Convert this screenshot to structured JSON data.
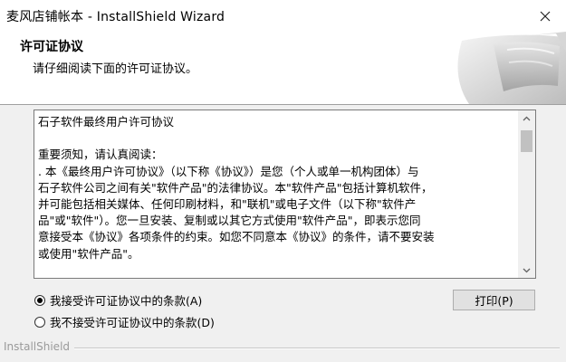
{
  "window": {
    "title": "麦风店铺帐本 - InstallShield Wizard",
    "close_icon": "close-icon"
  },
  "header": {
    "title": "许可证协议",
    "subtitle": "请仔细阅读下面的许可证协议。",
    "art_icon": "installshield-graphic"
  },
  "license": {
    "lines": [
      "石子软件最终用户许可协议",
      "",
      "重要须知，请认真阅读：",
      ". 本《最终用户许可协议》（以下称《协议》）是您（个人或单一机构团体）与",
      "石子软件公司之间有关\"软件产品\"的法律协议。本\"软件产品\"包括计算机软件，",
      "并可能包括相关媒体、任何印刷材料，和\"联机\"或电子文件（以下称\"软件产",
      "品\"或\"软件\"）。您一旦安装、复制或以其它方式使用\"软件产品\"，即表示您同",
      "意接受本《协议》各项条件的约束。如您不同意本《协议》的条件，请不要安装",
      "或使用\"软件产品\"。"
    ],
    "scroll_up_icon": "chevron-up-icon",
    "scroll_down_icon": "chevron-down-icon"
  },
  "options": {
    "accept_label": "我接受许可证协议中的条款(A)",
    "decline_label": "我不接受许可证协议中的条款(D)",
    "selected": "accept"
  },
  "buttons": {
    "print_label": "打印(P)"
  },
  "footer": {
    "brand": "InstallShield"
  }
}
